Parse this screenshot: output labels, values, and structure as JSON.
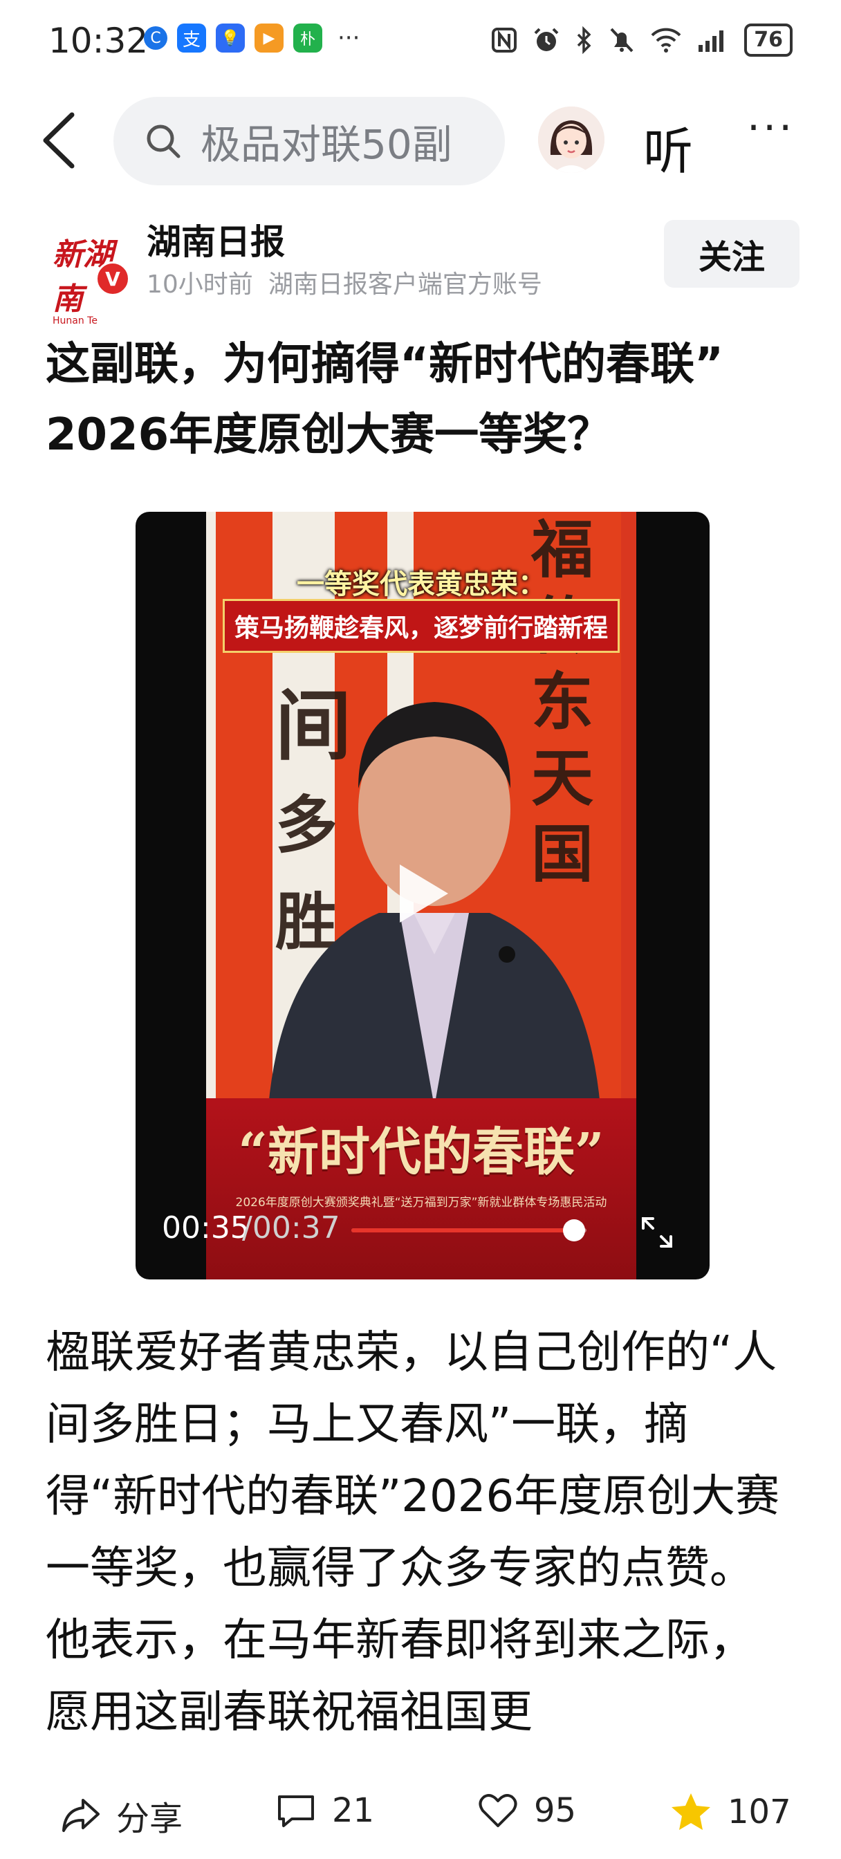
{
  "status_bar": {
    "time": "10:32",
    "battery": "76",
    "apps": [
      {
        "icon": "app-blue-c-icon",
        "glyph": "C",
        "color": "#1a73e8"
      },
      {
        "icon": "alipay-icon",
        "glyph": "支",
        "color": "#1677ff"
      },
      {
        "icon": "bulb-app-icon",
        "glyph": "💡",
        "color": "#2d6cf5"
      },
      {
        "icon": "orange-play-app-icon",
        "glyph": "▶",
        "color": "#f59a23"
      },
      {
        "icon": "green-app-icon",
        "glyph": "朴",
        "color": "#22b14c"
      }
    ],
    "more": "···"
  },
  "header": {
    "search_text": "极品对联50副",
    "listen_label": "听",
    "more_label": "···"
  },
  "account": {
    "logo_text": "新湖南",
    "logo_sub": "Hunan Te",
    "name": "湖南日报",
    "time_ago": "10小时前",
    "description": "湖南日报客户端官方账号",
    "follow_label": "关注",
    "verified_label": "V"
  },
  "article": {
    "title_line1": "这副联，为何摘得“新时代的春联”",
    "title_line2": "2026年度原创大赛一等奖？",
    "paragraph": "楹联爱好者黄忠荣，以自己创作的“人间多胜日；马上又春风”一联，摘得“新时代的春联”2026年度原创大赛一等奖，也赢得了众多专家的点赞。他表示，在马年新春即将到来之际，愿用这副春联祝福祖国更"
  },
  "video": {
    "caption_line1": "一等奖代表黄忠荣：",
    "caption_line2": "策马扬鞭趁春风，逐梦前行踏新程",
    "brand_title": "“新时代的春联”",
    "brand_subtitle": "2026年度原创大赛颁奖典礼暨“送万福到万家”新就业群体专场惠民活动",
    "current_time": "00:35",
    "total_time": "/00:37",
    "progress": 0.946
  },
  "bottom_bar": {
    "share_label": "分享",
    "comment_count": "21",
    "like_count": "95",
    "favorite_count": "107"
  },
  "colors": {
    "accent_red": "#e02a2a",
    "favorite_yellow": "#f7c600",
    "search_bg": "#f1f2f4"
  }
}
